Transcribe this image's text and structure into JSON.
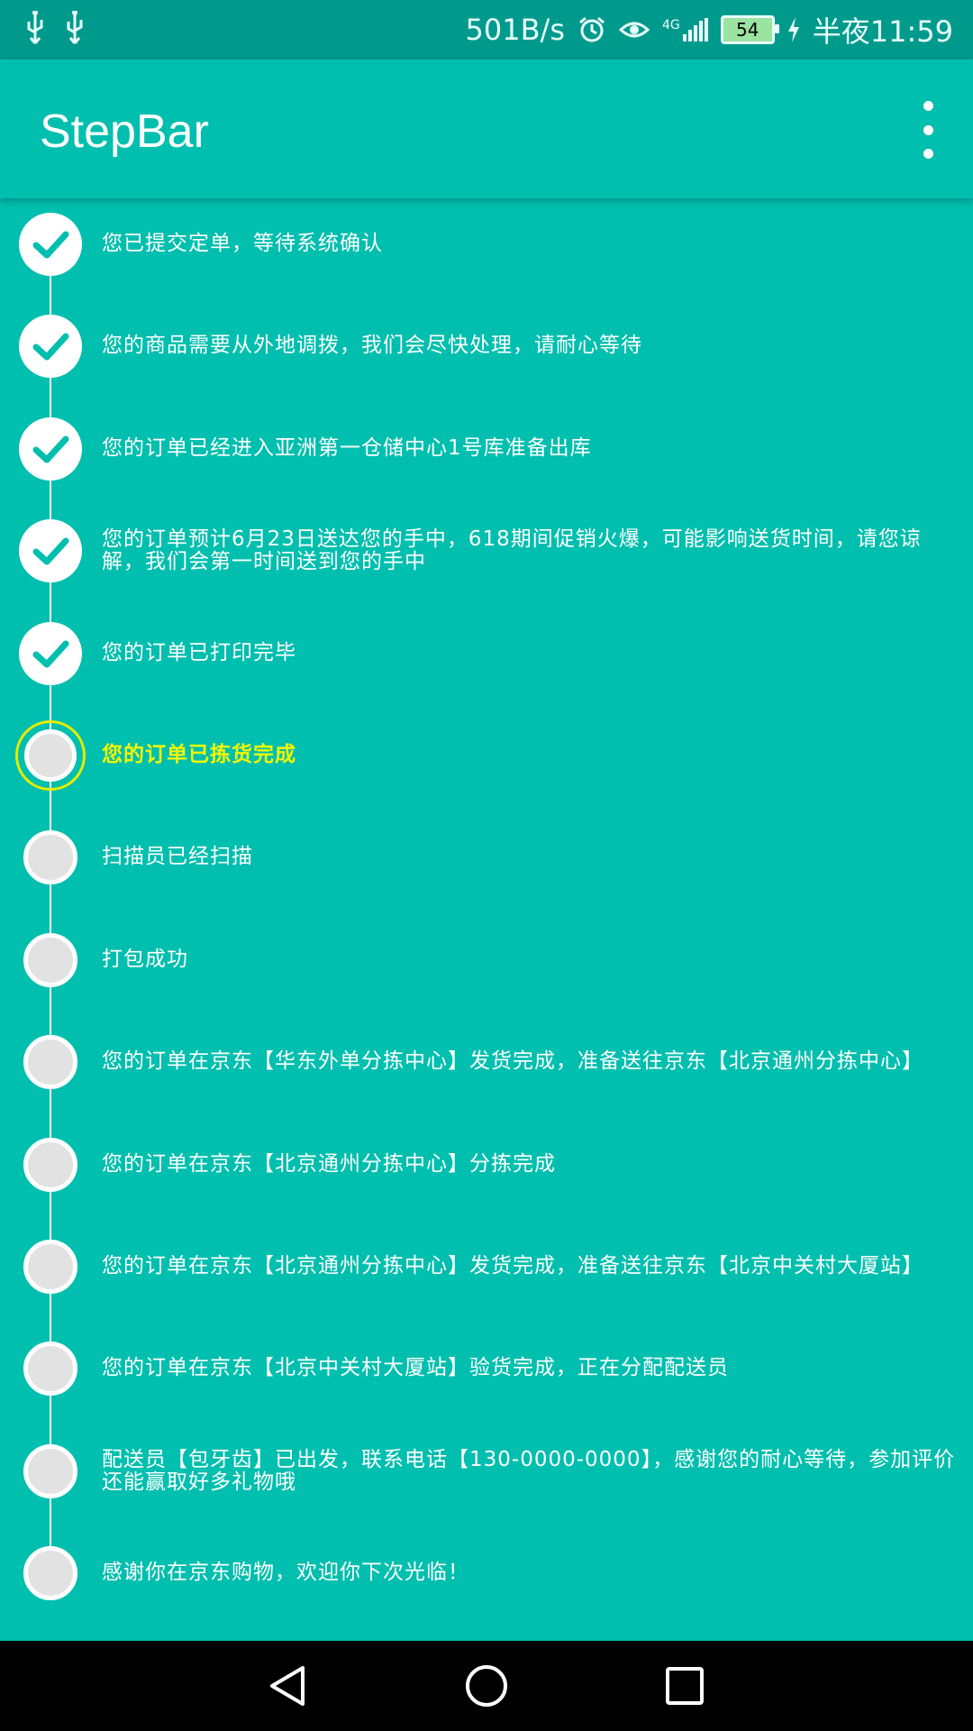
{
  "status_bar": {
    "network_speed": "501B/s",
    "network_type": "4G",
    "battery_level": "54",
    "time": "半夜11:59",
    "icons": [
      "usb-icon",
      "usb-icon",
      "alarm-icon",
      "eye-icon",
      "signal-icon",
      "battery-icon",
      "charging-icon"
    ]
  },
  "app_bar": {
    "title": "StepBar",
    "menu_icon": "more-vert-icon"
  },
  "steps": [
    {
      "text": "您已提交定单，等待系统确认",
      "state": "done"
    },
    {
      "text": "您的商品需要从外地调拨，我们会尽快处理，请耐心等待",
      "state": "done"
    },
    {
      "text": "您的订单已经进入亚洲第一仓储中心1号库准备出库",
      "state": "done"
    },
    {
      "text": "您的订单预计6月23日送达您的手中，618期间促销火爆，可能影响送货时间，请您谅解，我们会第一时间送到您的手中",
      "state": "done"
    },
    {
      "text": "您的订单已打印完毕",
      "state": "done"
    },
    {
      "text": "您的订单已拣货完成",
      "state": "current"
    },
    {
      "text": "扫描员已经扫描",
      "state": "pending"
    },
    {
      "text": "打包成功",
      "state": "pending"
    },
    {
      "text": "您的订单在京东【华东外单分拣中心】发货完成，准备送往京东【北京通州分拣中心】",
      "state": "pending"
    },
    {
      "text": "您的订单在京东【北京通州分拣中心】分拣完成",
      "state": "pending"
    },
    {
      "text": "您的订单在京东【北京通州分拣中心】发货完成，准备送往京东【北京中关村大厦站】",
      "state": "pending"
    },
    {
      "text": "您的订单在京东【北京中关村大厦站】验货完成，正在分配配送员",
      "state": "pending"
    },
    {
      "text": "配送员【包牙齿】已出发，联系电话【130-0000-0000】，感谢您的耐心等待，参加评价还能赢取好多礼物哦",
      "state": "pending"
    },
    {
      "text": "感谢你在京东购物，欢迎你下次光临！",
      "state": "pending"
    }
  ],
  "colors": {
    "background": "#00BFAE",
    "status_bar": "#009A8D",
    "current_text": "#F3F700",
    "current_ring": "#E7EC00",
    "pending_fill": "#E2E2E2"
  },
  "nav_bar": {
    "icons": [
      "back-icon",
      "home-icon",
      "recents-icon"
    ]
  }
}
